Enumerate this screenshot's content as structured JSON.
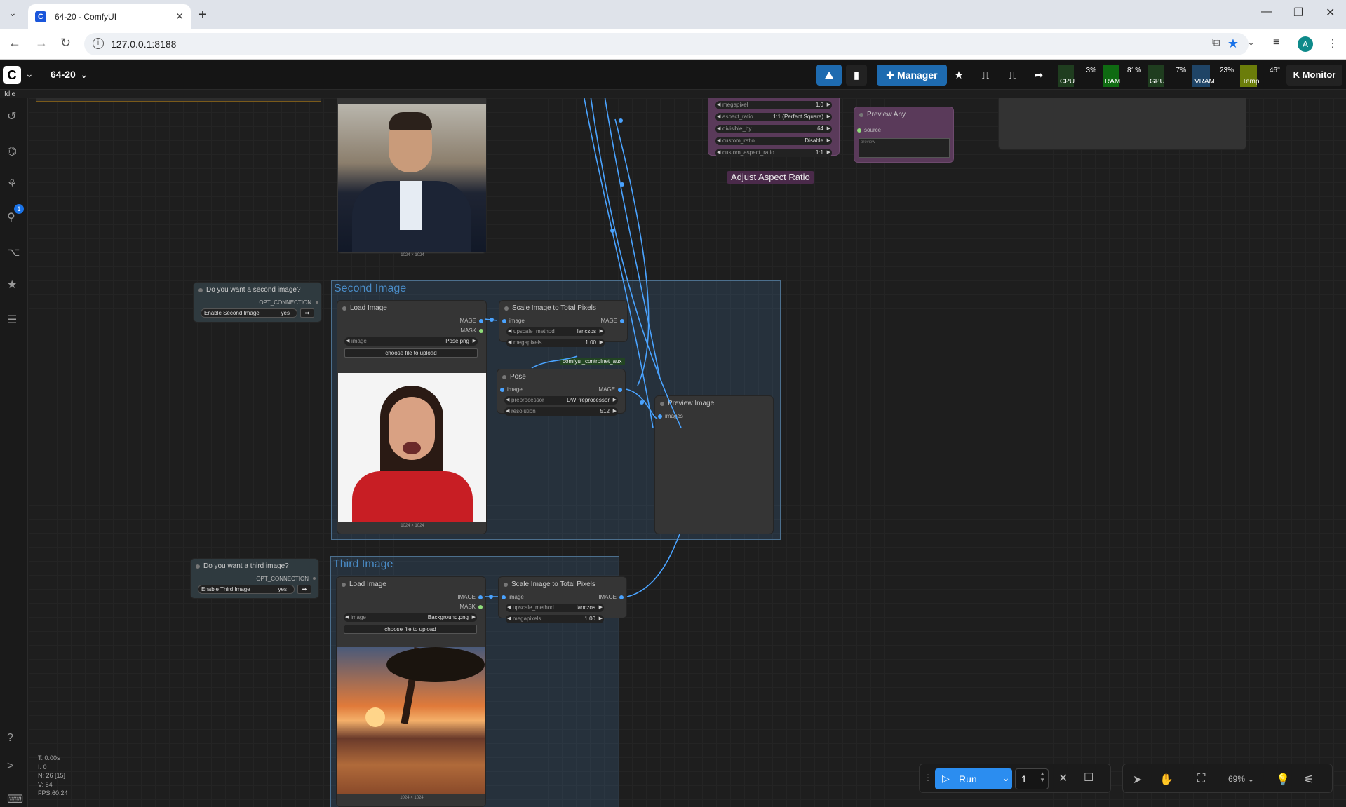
{
  "browser": {
    "tab_title": "64-20 - ComfyUI",
    "url": "127.0.0.1:8188",
    "avatar_initial": "A"
  },
  "topbar": {
    "workflow_name": "64-20",
    "manager_label": "Manager",
    "monitor_label": "Monitor",
    "status": "Idle",
    "monitors": [
      {
        "label": "CPU",
        "value": "3%",
        "color": "#1f3d1f"
      },
      {
        "label": "RAM",
        "value": "81%",
        "color": "#0f6b12"
      },
      {
        "label": "GPU",
        "value": "7%",
        "color": "#1f3d1f"
      },
      {
        "label": "VRAM",
        "value": "23%",
        "color": "#1f4466"
      },
      {
        "label": "Temp",
        "value": "46°",
        "color": "#6b7d0a"
      }
    ]
  },
  "sidebar": {
    "badge_count": "1"
  },
  "groups": {
    "second": "Second Image",
    "third": "Third Image"
  },
  "nodes": {
    "q2": {
      "title": "Do you want a second image?",
      "out": "OPT_CONNECTION",
      "toggle_label": "Enable Second Image",
      "toggle_value": "yes"
    },
    "q3": {
      "title": "Do you want a third image?",
      "out": "OPT_CONNECTION",
      "toggle_label": "Enable Third Image",
      "toggle_value": "yes"
    },
    "load2": {
      "title": "Load Image",
      "out1": "IMAGE",
      "out2": "MASK",
      "image_label": "image",
      "image_value": "Pose.png",
      "upload": "choose file to upload",
      "dims": "1024 × 1024"
    },
    "load3": {
      "title": "Load Image",
      "out1": "IMAGE",
      "out2": "MASK",
      "image_label": "image",
      "image_value": "Background.png",
      "upload": "choose file to upload",
      "dims": "1024 × 1024"
    },
    "load1": {
      "dims": "1024 × 1024"
    },
    "scale2": {
      "title": "Scale Image to Total Pixels",
      "in": "image",
      "out": "IMAGE",
      "w1_label": "upscale_method",
      "w1_value": "lanczos",
      "w2_label": "megapixels",
      "w2_value": "1.00"
    },
    "scale3": {
      "title": "Scale Image to Total Pixels",
      "in": "image",
      "out": "IMAGE",
      "w1_label": "upscale_method",
      "w1_value": "lanczos",
      "w2_label": "megapixels",
      "w2_value": "1.00"
    },
    "pose": {
      "title": "Pose",
      "tag": "comfyui_controlnet_aux",
      "in": "image",
      "out": "IMAGE",
      "w1_label": "preprocessor",
      "w1_value": "DWPreprocessor",
      "w2_label": "resolution",
      "w2_value": "512"
    },
    "preview": {
      "title": "Preview Image",
      "in": "images"
    },
    "aspect": {
      "title": "Adjust Aspect Ratio",
      "rows": [
        {
          "label": "megapixel",
          "value": "1.0"
        },
        {
          "label": "aspect_ratio",
          "value": "1:1 (Perfect Square)"
        },
        {
          "label": "divisible_by",
          "value": "64"
        },
        {
          "label": "custom_ratio",
          "value": "Disable"
        },
        {
          "label": "custom_aspect_ratio",
          "value": "1:1"
        }
      ]
    },
    "previewany": {
      "title": "Preview Any",
      "in": "source",
      "placeholder": "preview"
    }
  },
  "stats": {
    "t": "T: 0.00s",
    "i": "I: 0",
    "n": "N: 26 [15]",
    "v": "V: 54",
    "fps": "FPS:60.24"
  },
  "bottom": {
    "run_label": "Run",
    "queue_count": "1",
    "zoom": "69%"
  }
}
